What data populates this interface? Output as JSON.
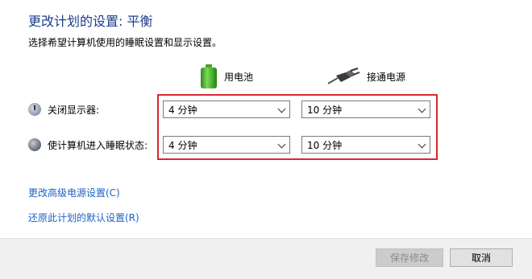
{
  "header": {
    "title": "更改计划的设置: 平衡",
    "subtitle": "选择希望计算机使用的睡眠设置和显示设置。"
  },
  "columns": {
    "battery": {
      "label": "用电池",
      "icon": "battery-icon"
    },
    "plugged_in": {
      "label": "接通电源",
      "icon": "power-plug-icon"
    }
  },
  "rows": {
    "display_off": {
      "label": "关闭显示器:",
      "icon": "display-icon",
      "battery_value": "4 分钟",
      "plugged_value": "10 分钟"
    },
    "sleep": {
      "label": "使计算机进入睡眠状态:",
      "icon": "sleep-icon",
      "battery_value": "4 分钟",
      "plugged_value": "10 分钟"
    }
  },
  "links": {
    "advanced": "更改高级电源设置(C)",
    "restore": "还原此计划的默认设置(R)"
  },
  "buttons": {
    "save": "保存修改",
    "cancel": "取消"
  },
  "colors": {
    "title": "#1e3c8c",
    "link": "#1b63c6",
    "highlight_border": "#d8282f",
    "footer_bg": "#f0f0f0"
  }
}
